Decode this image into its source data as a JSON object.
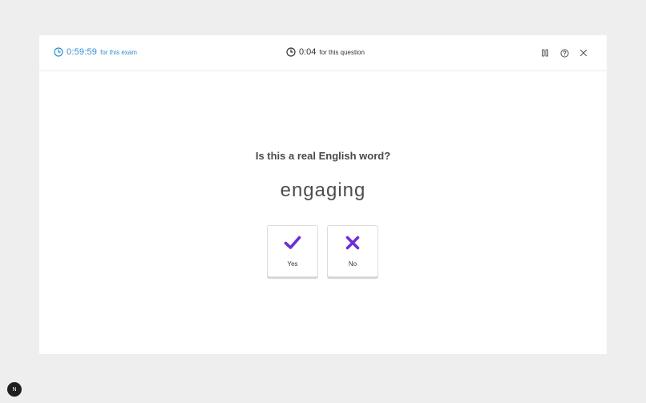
{
  "header": {
    "exam_time": "0:59:59",
    "exam_caption": "for this exam",
    "question_time": "0:04",
    "question_caption": "for this question",
    "icons": [
      "pause-icon",
      "help-icon",
      "close-icon"
    ]
  },
  "question": {
    "prompt": "Is this a real English word?",
    "word": "engaging"
  },
  "answers": {
    "yes_label": "Yes",
    "no_label": "No"
  },
  "corner_badge": {
    "label": "N"
  },
  "colors": {
    "accent_blue": "#2e8fcf",
    "answer_purple": "#6b2fd9",
    "background": "#eeeeee"
  }
}
